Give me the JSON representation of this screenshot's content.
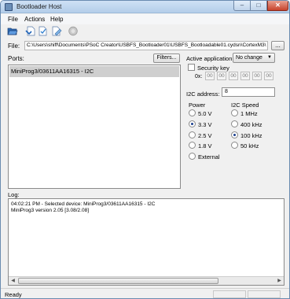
{
  "window": {
    "title": "Bootloader Host",
    "min": "–",
    "max": "□",
    "close": "✕"
  },
  "menu": [
    "File",
    "Actions",
    "Help"
  ],
  "toolbar": {
    "icons": [
      "open-folder-icon",
      "program-icon",
      "verify-icon",
      "erase-icon",
      "stop-icon"
    ]
  },
  "file": {
    "label": "File:",
    "path": "C:\\Users\\shiff\\Documents\\PSoC Creator\\USBFS_Bootloader01\\USBFS_Bootloadable01.cydsn\\CortexM3\\",
    "browse_label": "..."
  },
  "ports": {
    "label": "Ports:",
    "filters_label": "Filters...",
    "items": [
      "MiniProg3/03611AA16315 - I2C"
    ]
  },
  "active_application": {
    "label": "Active application:",
    "value": "No change",
    "arrow": "▼"
  },
  "security_key": {
    "label": "Security key",
    "checked": false,
    "prefix": "0x:",
    "bytes": [
      "00",
      "00",
      "00",
      "00",
      "00",
      "00"
    ]
  },
  "i2c_address": {
    "label": "I2C address:",
    "value": "8"
  },
  "power": {
    "title": "Power",
    "options": [
      {
        "label": "5.0 V",
        "selected": false
      },
      {
        "label": "3.3 V",
        "selected": true
      },
      {
        "label": "2.5 V",
        "selected": false
      },
      {
        "label": "1.8 V",
        "selected": false
      },
      {
        "label": "External",
        "selected": false
      }
    ]
  },
  "i2c_speed": {
    "title": "I2C Speed",
    "options": [
      {
        "label": "1 MHz",
        "selected": false
      },
      {
        "label": "400 kHz",
        "selected": false
      },
      {
        "label": "100 kHz",
        "selected": true
      },
      {
        "label": "50 kHz",
        "selected": false
      }
    ]
  },
  "log": {
    "label": "Log:",
    "lines": [
      "04:02:21 PM - Selected device: MiniProg3/03611AA16315 - I2C",
      "MiniProg3 version 2.05 [3.08/2.08]"
    ],
    "scroll_left": "◀",
    "scroll_right": "▶"
  },
  "status": {
    "text": "Ready"
  }
}
